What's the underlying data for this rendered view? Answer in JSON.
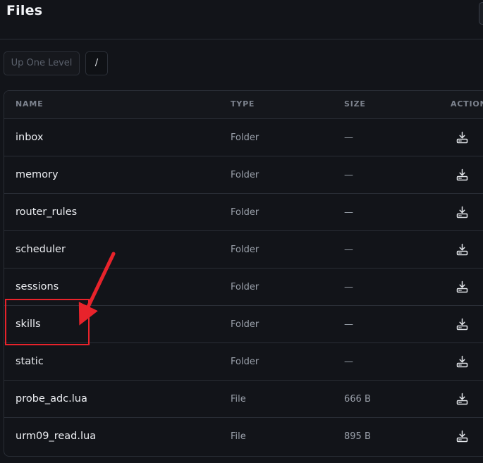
{
  "header": {
    "title": "Files"
  },
  "toolbar": {
    "up_label": "Up One Level",
    "path": "/"
  },
  "table": {
    "columns": [
      "NAME",
      "TYPE",
      "SIZE",
      "ACTIONS"
    ],
    "rows": [
      {
        "name": "inbox",
        "type": "Folder",
        "size": "—"
      },
      {
        "name": "memory",
        "type": "Folder",
        "size": "—"
      },
      {
        "name": "router_rules",
        "type": "Folder",
        "size": "—"
      },
      {
        "name": "scheduler",
        "type": "Folder",
        "size": "—"
      },
      {
        "name": "sessions",
        "type": "Folder",
        "size": "—"
      },
      {
        "name": "skills",
        "type": "Folder",
        "size": "—"
      },
      {
        "name": "static",
        "type": "Folder",
        "size": "—"
      },
      {
        "name": "probe_adc.lua",
        "type": "File",
        "size": "666 B"
      },
      {
        "name": "urm09_read.lua",
        "type": "File",
        "size": "895 B"
      }
    ],
    "action_icon": "download-icon"
  },
  "colors": {
    "background": "#121419",
    "border": "#2a2e36",
    "text": "#eceef2",
    "muted": "#9aa0aa",
    "annotation": "#e8232b"
  }
}
